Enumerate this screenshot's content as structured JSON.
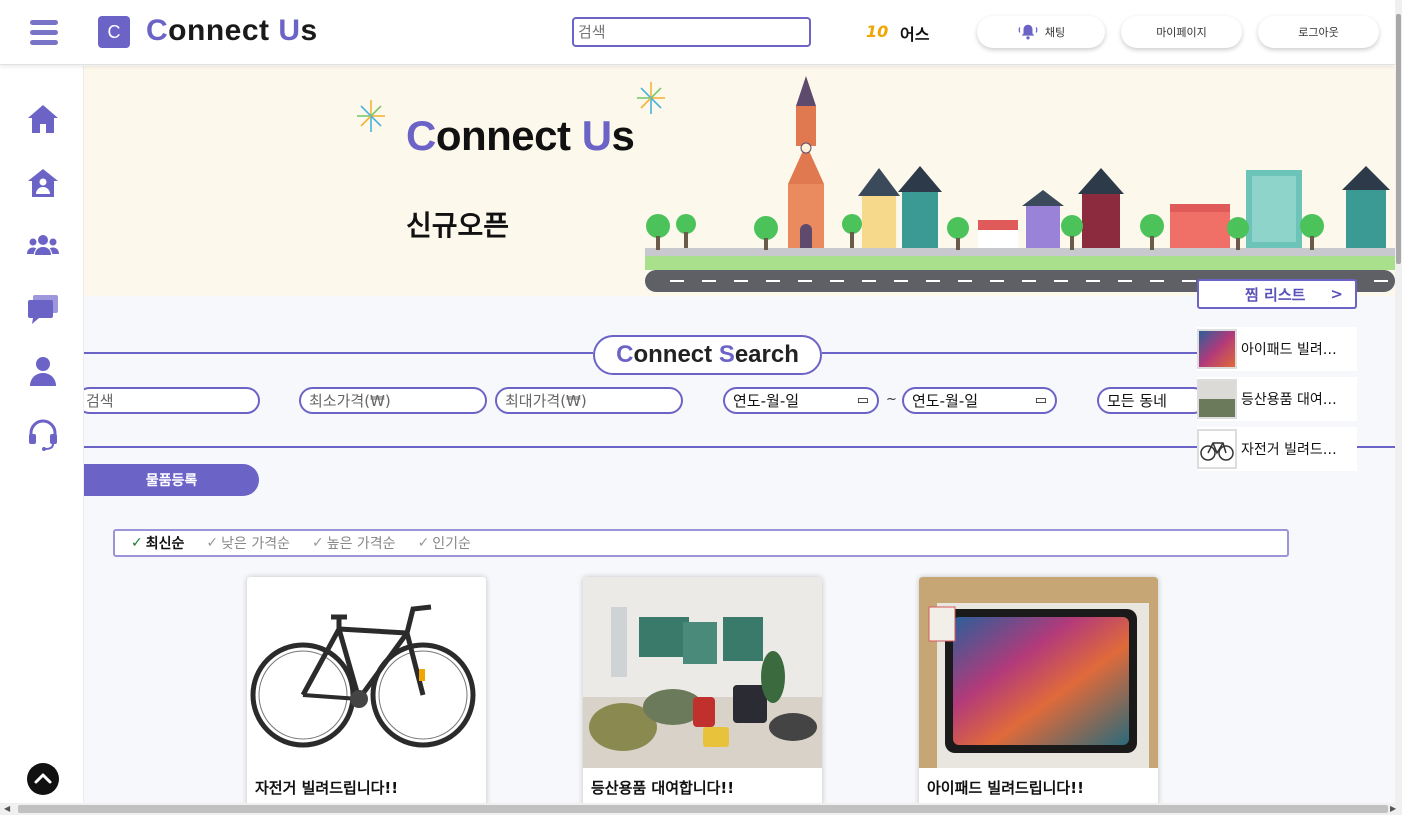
{
  "header": {
    "logo_letter": "C",
    "brand_a": "C",
    "brand_b": "onnect ",
    "brand_c": "U",
    "brand_d": "s",
    "search_placeholder": "검색",
    "points_value": "10",
    "points_unit": "어스",
    "chat_label": "채팅",
    "mypage_label": "마이페이지",
    "logout_label": "로그아웃"
  },
  "sidebar": {
    "icons": [
      "home-icon",
      "neighborhood-icon",
      "group-icon",
      "chat-icon",
      "user-icon",
      "support-headset-icon",
      "scroll-top-icon"
    ]
  },
  "banner": {
    "title_a": "C",
    "title_b": "onnect ",
    "title_c": "U",
    "title_d": "s",
    "subtitle": "신규오픈"
  },
  "search": {
    "heading_a": "C",
    "heading_b": "onnect ",
    "heading_c": "S",
    "heading_d": "earch",
    "keyword_placeholder": "검색",
    "min_price_placeholder": "최소가격(₩)",
    "max_price_placeholder": "최대가격(₩)",
    "date_from": "연도-월-일",
    "date_to": "연도-월-일",
    "date_separator": "~",
    "region_value": "모든 동네",
    "register_label": "물품등록"
  },
  "sort": {
    "options": [
      "최신순",
      "낮은 가격순",
      "높은 가격순",
      "인기순"
    ],
    "active": "최신순"
  },
  "products": [
    {
      "title": "자전거 빌려드립니다!!"
    },
    {
      "title": "등산용품 대여합니다!!"
    },
    {
      "title": "아이패드 빌려드립니다!!"
    }
  ],
  "wishlist": {
    "title": "찜 리스트",
    "arrow": ">",
    "items": [
      {
        "label": "아이패드 빌려…"
      },
      {
        "label": "등산용품 대여…"
      },
      {
        "label": "자전거 빌려드…"
      }
    ]
  },
  "colors": {
    "accent": "#6c63c7",
    "points": "#f0a500",
    "banner_bg": "#fdf8ec",
    "active_check": "#1a7a2e"
  }
}
